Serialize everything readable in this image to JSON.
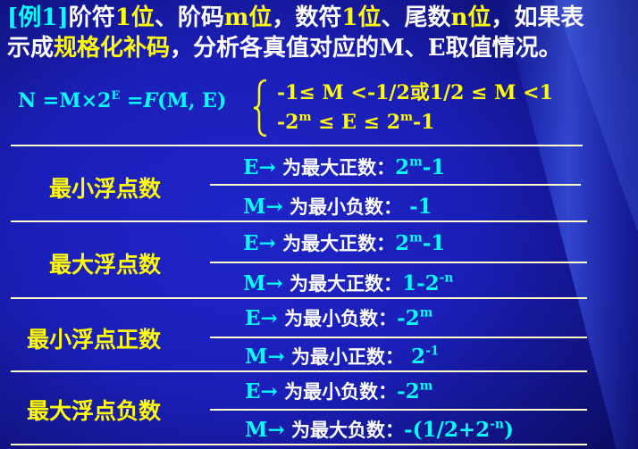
{
  "title": {
    "bracket": "[例1]",
    "line1": [
      "阶符",
      "1位",
      "、阶码",
      "m位",
      "，数符",
      "1位",
      "、尾数",
      "n位",
      "，如果表"
    ],
    "line2": [
      "示成",
      "规格化补码",
      "，分析各真值对应的M、E取值情况。"
    ]
  },
  "formula": {
    "lhs": "N =M",
    "times": "×",
    "two": "2",
    "exp": "E",
    "eq": " =",
    "fn": "F",
    "args": "(M, E)"
  },
  "conditions": {
    "c1": "-1≤ M <-1/2或1/2 ≤ M <1",
    "c2_base": "-2",
    "c2_exp1": "m",
    "c2_mid": " ≤ E ≤ 2",
    "c2_exp2": "m",
    "c2_end": "-1"
  },
  "sections": [
    {
      "label": "最小浮点数",
      "rows": [
        {
          "sym": "E",
          "arrow": "→",
          "desc": " 为最大正数：",
          "base": "2",
          "exp": "m",
          "tail": "-1"
        },
        {
          "sym": "M",
          "arrow": "→",
          "desc": " 为最小负数：",
          "base": " -1",
          "exp": "",
          "tail": ""
        }
      ]
    },
    {
      "label": "最大浮点数",
      "rows": [
        {
          "sym": "E",
          "arrow": "→",
          "desc": "  为最大正数：",
          "base": "2",
          "exp": "m",
          "tail": "-1"
        },
        {
          "sym": "M",
          "arrow": "→",
          "desc": " 为最大正数：",
          "base": "1-2",
          "exp": "-n",
          "tail": ""
        }
      ]
    },
    {
      "label": "最小浮点正数",
      "rows": [
        {
          "sym": "E",
          "arrow": "→",
          "desc": "  为最小负数：",
          "base": "-2",
          "exp": "m",
          "tail": ""
        },
        {
          "sym": "M",
          "arrow": "→",
          "desc": " 为最小正数：",
          "base": " 2",
          "exp": "-1",
          "tail": ""
        }
      ]
    },
    {
      "label": "最大浮点负数",
      "rows": [
        {
          "sym": "E",
          "arrow": "→",
          "desc": "  为最小负数：",
          "base": "-2",
          "exp": "m",
          "tail": ""
        },
        {
          "sym": "M",
          "arrow": "→",
          "desc": " 为最大负数：",
          "base": "-(1/2+2",
          "exp": "-n",
          "tail": ")"
        }
      ]
    }
  ]
}
